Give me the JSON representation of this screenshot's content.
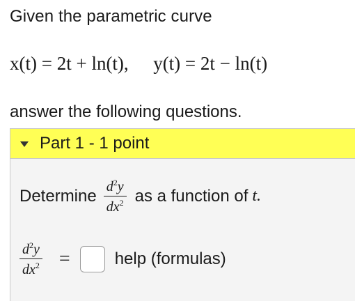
{
  "problem": {
    "intro": "Given the parametric curve",
    "x_def": "x(t) = 2t + ln(t),",
    "y_def": "y(t) = 2t − ln(t)",
    "answer_intro": "answer the following questions."
  },
  "part": {
    "title": "Part 1 - 1 point",
    "prompt_prefix": "Determine",
    "prompt_suffix": "as a function of",
    "prompt_var": "t.",
    "fraction_num": "d",
    "fraction_num_sup": "2",
    "fraction_num_var": "y",
    "fraction_den": "dx",
    "fraction_den_sup": "2",
    "equals": "=",
    "answer_value": "",
    "help_label": "help (formulas)"
  },
  "colors": {
    "header_bg": "#ffff55",
    "body_bg": "#f4f4f4"
  }
}
